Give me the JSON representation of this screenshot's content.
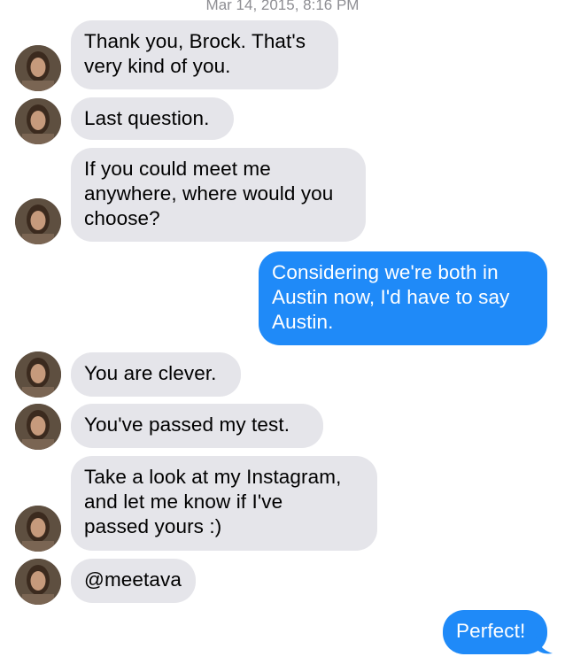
{
  "conversation": {
    "timestamp": "Mar 14, 2015, 8:16 PM",
    "colors": {
      "incoming_bubble": "#e5e5ea",
      "outgoing_bubble": "#1f8af8",
      "timestamp_text": "#8e8e93"
    },
    "messages": [
      {
        "sender": "them",
        "text": "Thank you, Brock. That's\nvery kind of you."
      },
      {
        "sender": "them",
        "text": "Last question."
      },
      {
        "sender": "them",
        "text": "If you could meet me\nanywhere, where would you\nchoose?"
      },
      {
        "sender": "me",
        "text": "Considering we're both in\nAustin now, I'd have to say\nAustin."
      },
      {
        "sender": "them",
        "text": "You are clever."
      },
      {
        "sender": "them",
        "text": "You've passed my test."
      },
      {
        "sender": "them",
        "text": "Take a look at my Instagram,\nand let me know if I've\npassed yours :)"
      },
      {
        "sender": "them",
        "text": "@meetava"
      },
      {
        "sender": "me",
        "text": "Perfect!"
      }
    ]
  }
}
